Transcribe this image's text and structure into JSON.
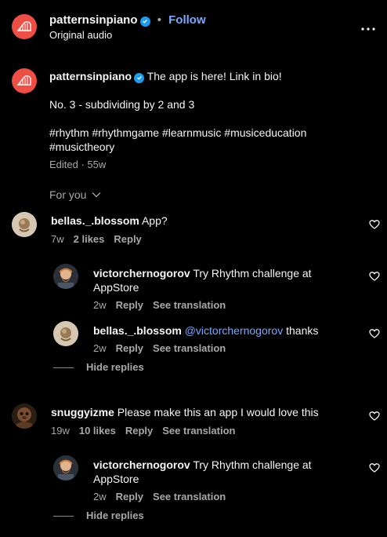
{
  "header": {
    "username": "patternsinpiano",
    "dot": "•",
    "follow_label": "Follow",
    "subtitle": "Original audio",
    "more_icon": "more-horizontal-icon"
  },
  "caption": {
    "username": "patternsinpiano",
    "text_line1": "The app is here! Link in bio!",
    "text_line2": "No. 3 - subdividing by 2 and 3",
    "hashtags_line1": "#rhythm #rhythmgame #learnmusic #musiceducation",
    "hashtags_line2": "#musictheory",
    "meta": "Edited · 55w"
  },
  "filter": {
    "label": "For you"
  },
  "comments": [
    {
      "username": "bellas._.blossom",
      "text": "App?",
      "time": "7w",
      "likes": "2 likes",
      "reply": "Reply"
    },
    {
      "username": "victorchernogorov",
      "text_line1": "Try Rhythm challenge at",
      "text_line2": "AppStore",
      "time": "2w",
      "reply": "Reply",
      "translate": "See translation"
    },
    {
      "username": "bellas._.blossom",
      "mention": "@victorchernogorov",
      "text": "thanks",
      "time": "2w",
      "reply": "Reply",
      "translate": "See translation"
    },
    {
      "hide_replies": "Hide replies"
    },
    {
      "username": "snuggyizme",
      "text": "Please make this an app I would love this",
      "time": "19w",
      "likes": "10 likes",
      "reply": "Reply",
      "translate": "See translation"
    },
    {
      "username": "victorchernogorov",
      "text_line1": "Try Rhythm challenge at",
      "text_line2": "AppStore",
      "time": "2w",
      "reply": "Reply",
      "translate": "See translation"
    },
    {
      "hide_replies": "Hide replies"
    }
  ],
  "colors": {
    "background": "#000000",
    "brand": "#ef4e45",
    "link": "#7aa8ff",
    "verified": "#1d9bf0"
  }
}
